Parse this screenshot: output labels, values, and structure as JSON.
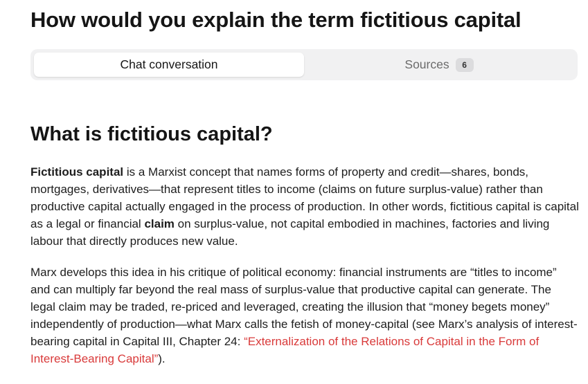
{
  "page": {
    "title": "How would you explain the term fictitious capital"
  },
  "tabs": {
    "chat_label": "Chat conversation",
    "sources_label": "Sources",
    "sources_count": "6"
  },
  "content": {
    "heading": "What is fictitious capital?",
    "para1": {
      "bold_term": "Fictitious capital",
      "text1": " is a Marxist concept that names forms of property and credit—shares, bonds, mortgages, derivatives—that represent titles to income (claims on future surplus-value) rather than productive capital actually engaged in the process of production. In other words, fictitious capital is capital as a legal or financial ",
      "bold_claim": "claim",
      "text2": " on surplus-value, not capital embodied in machines, factories and living labour that directly produces new value."
    },
    "para2": {
      "text": "Marx develops this idea in his critique of political economy: financial instruments are “titles to income” and can multiply far beyond the real mass of surplus-value that productive capital can generate. The legal claim may be traded, re-priced and leveraged, creating the illusion that “money begets money” independently of production—what Marx calls the fetish of money-capital (see Marx’s analysis of interest-bearing capital in Capital III, Chapter 24: ",
      "link_text": "“Externalization of the Relations of Capital in the Form of Interest-Bearing Capital”",
      "tail": ")."
    }
  },
  "colors": {
    "link": "#d93a3a",
    "tab_bar_bg": "#f1f1f2",
    "badge_bg": "#dcdcde"
  }
}
